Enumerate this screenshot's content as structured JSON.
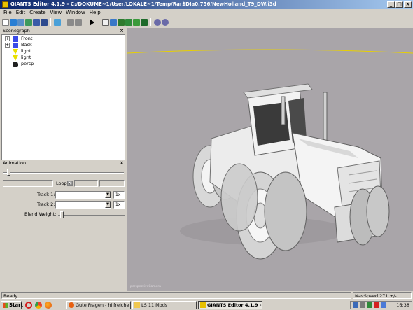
{
  "window": {
    "title": "GIANTS Editor 4.1.9 - C:/DOKUME~1/User/LOKALE~1/Temp/Rar$DIa0.756/NewHolland_T9_DW.i3d",
    "minimize": "_",
    "maximize": "□",
    "close": "×"
  },
  "menu": [
    "File",
    "Edit",
    "Create",
    "View",
    "Window",
    "Help"
  ],
  "toolbar_icons": [
    "new-icon",
    "open-icon",
    "import-icon",
    "export-icon",
    "save-icon",
    "save-all-icon",
    "refresh-icon",
    "undo-icon",
    "redo-icon",
    "play-icon",
    "select-icon",
    "move-icon",
    "terrain-icon",
    "paint-icon",
    "foliage-icon",
    "decal-icon",
    "settings-icon",
    "options-icon"
  ],
  "scenegraph": {
    "title": "Scenegraph",
    "close": "×",
    "items": [
      {
        "label": "Front",
        "icon": "camera-icon",
        "expandable": true
      },
      {
        "label": "Back",
        "icon": "camera-icon",
        "expandable": true
      },
      {
        "label": "light",
        "icon": "light-icon",
        "expandable": false
      },
      {
        "label": "light",
        "icon": "light-icon",
        "expandable": false
      },
      {
        "label": "persp",
        "icon": "persp-camera-icon",
        "expandable": false
      }
    ]
  },
  "animation": {
    "title": "Animation",
    "close": "×",
    "loop_label": "Loop",
    "loop_checked": "☑",
    "track1_label": "Track 1:",
    "track1_scale": "1x",
    "track2_label": "Track 2:",
    "track2_scale": "1x",
    "blend_weight_label": "Blend Weight:"
  },
  "viewport": {
    "background": "#a9a5a9",
    "horizon_color": "#e8d000",
    "camera_label": "perspectiveCamera"
  },
  "status": {
    "text": "Ready",
    "navspeed": "NavSpeed 271 +/-"
  },
  "taskbar": {
    "start_label": "Start",
    "quicklaunch": [
      "opera-icon",
      "chrome-icon",
      "firefox-icon"
    ],
    "tasks": [
      {
        "label": "Gute Fragen - hilfreiche ...",
        "active": false,
        "icon": "firefox-icon"
      },
      {
        "label": "LS 11 Mods",
        "active": false,
        "icon": "folder-icon"
      },
      {
        "label": "GIANTS Editor 4.1.9 - ...",
        "active": true,
        "icon": "giants-icon"
      }
    ],
    "tray_icons": [
      "network-icon",
      "volume-icon",
      "shield-icon",
      "antivirus-icon",
      "update-icon"
    ],
    "clock": "16:38"
  }
}
